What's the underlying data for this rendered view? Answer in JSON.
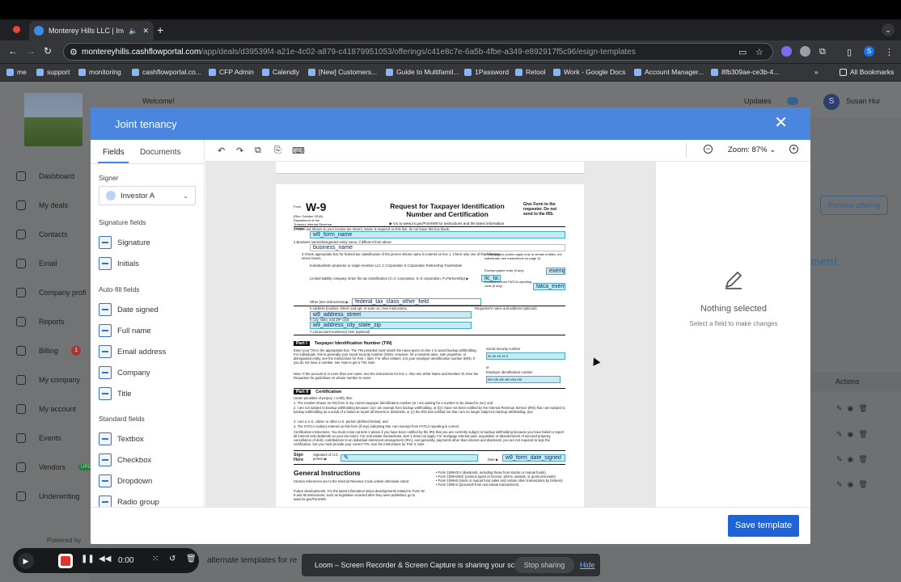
{
  "browser": {
    "tab_title": "Monterey Hills LLC | Inves",
    "url_domain": "montereyhills.cashflowportal.com",
    "url_path": "/app/deals/d39539f4-a21e-4c02-a879-c41879951053/offerings/c41e8c7e-6a5b-4fbe-a349-e892917f5c96/esign-templates",
    "bookmarks": [
      "me",
      "support",
      "monitoring",
      "cashflowportal.co...",
      "CFP Admin",
      "Calendly",
      "[New] Customers...",
      "Guide to Multifamil...",
      "1Password",
      "Retool",
      "Work - Google Docs",
      "Account Manager...",
      "8fb309ae-ce3b-4..."
    ],
    "all_bookmarks": "All Bookmarks",
    "profile_initial": "S"
  },
  "app": {
    "welcome": "Welcome!",
    "updates": "Updates",
    "user_initial": "S",
    "user_name": "Susan Hur",
    "preview_offering": "Preview offering",
    "bg_word": "ment",
    "actions_header": "Actions",
    "powered_by": "Powered by",
    "alt_templates_text": "alternate templates for re",
    "sidebar": [
      {
        "label": "Dashboard"
      },
      {
        "label": "My deals"
      },
      {
        "label": "Contacts"
      },
      {
        "label": "Email"
      },
      {
        "label": "Company profi"
      },
      {
        "label": "Reports"
      },
      {
        "label": "Billing",
        "badge": "1"
      },
      {
        "label": "My company"
      },
      {
        "label": "My account"
      },
      {
        "label": "Events"
      },
      {
        "label": "Vendors",
        "badge": "UPDA"
      },
      {
        "label": "Underwriting"
      }
    ]
  },
  "modal": {
    "title": "Joint tenancy",
    "tabs": {
      "fields": "Fields",
      "documents": "Documents"
    },
    "signer_label": "Signer",
    "signer_value": "Investor A",
    "signer_initial": "IA",
    "signature_fields_label": "Signature fields",
    "signature_fields": [
      "Signature",
      "Initials"
    ],
    "autofill_label": "Auto-fill fields",
    "autofill_fields": [
      "Date signed",
      "Full name",
      "Email address",
      "Company",
      "Title"
    ],
    "standard_label": "Standard fields",
    "standard_fields": [
      "Textbox",
      "Checkbox",
      "Dropdown",
      "Radio group"
    ],
    "zoom": "Zoom: 87%",
    "nothing_selected": "Nothing selected",
    "nothing_sub": "Select a field to make changes",
    "save_button": "Save template"
  },
  "w9": {
    "form": "W-9",
    "form_label": "Form",
    "rev": "(Rev. October 2018) Department of the Treasury Internal Revenue Service",
    "title": "Request for Taxpayer Identification Number and Certification",
    "goto": "▶ Go to www.irs.gov/FormW9 for instructions and the latest information.",
    "give": "Give Form to the requester. Do not send to the IRS.",
    "line1": "1 Name (as shown on your income tax return). Name is required on this line; do not leave this line blank.",
    "line2": "2 Business name/disregarded entity name, if different from above",
    "line3": "3 Check appropriate box for federal tax classification of the person whose name is entered on line 1. Check only one of the following seven boxes.",
    "classes": "Individual/sole proprietor or single-member LLC   C Corporation   S Corporation   Partnership   Trust/estate",
    "llc": "Limited liability company. Enter the tax classification (C=C corporation, S=S corporation, P=Partnership) ▶",
    "other": "Other (see instructions) ▶",
    "line5": "5 Address (number, street, and apt. or suite no.) See instructions.",
    "requester": "Requester's name and address (optional)",
    "line6": "6 City, state, and ZIP code",
    "line7": "7 List account number(s) here (optional)",
    "exemptions": "4 Exemptions (codes apply only to certain entities, not individuals; see instructions on page 3):",
    "exempt_payee": "Exempt payee code (if any)",
    "fatca_label": "Exemption from FATCA reporting code (if any)",
    "fields": {
      "form_name": "w9_form_name",
      "business_name": "business_name",
      "llc": "llc_ta:",
      "exempt": "exemp",
      "fatca": "fatca_exempl",
      "other": "federal_tax_class_other_field",
      "address": "w9_address_street",
      "city": "w9_address_city_state_zip",
      "ssn": "ss ss ss ss s",
      "ein": "ein ein ein ein ein ein",
      "date": "w9_form_date_signed"
    },
    "part1": "Part I",
    "part1_title": "Taxpayer Identification Number (TIN)",
    "part1_text": "Enter your TIN in the appropriate box. The TIN provided must match the name given on line 1 to avoid backup withholding. For individuals, this is generally your social security number (SSN). However, for a resident alien, sole proprietor, or disregarded entity, see the instructions for Part I, later. For other entities, it is your employer identification number (EIN). If you do not have a number, see How to get a TIN, later.",
    "note": "Note: If the account is in more than one name, see the instructions for line 1. Also see What Name and Number To Give the Requester for guidelines on whose number to enter.",
    "ssn_label": "Social security number",
    "or": "or",
    "ein_label": "Employer identification number",
    "part2": "Part II",
    "part2_title": "Certification",
    "cert_intro": "Under penalties of perjury, I certify that:",
    "cert1": "1. The number shown on this form is my correct taxpayer identification number (or I am waiting for a number to be issued to me); and",
    "cert2": "2. I am not subject to backup withholding because: (a) I am exempt from backup withholding, or (b) I have not been notified by the Internal Revenue Service (IRS) that I am subject to backup withholding as a result of a failure to report all interest or dividends, or (c) the IRS has notified me that I am no longer subject to backup withholding; and",
    "cert3": "3. I am a U.S. citizen or other U.S. person (defined below); and",
    "cert4": "4. The FATCA code(s) entered on this form (if any) indicating that I am exempt from FATCA reporting is correct.",
    "cert_instr": "Certification instructions. You must cross out item 2 above if you have been notified by the IRS that you are currently subject to backup withholding because you have failed to report all interest and dividends on your tax return. For real estate transactions, item 2 does not apply. For mortgage interest paid, acquisition or abandonment of secured property, cancellation of debt, contributions to an individual retirement arrangement (IRA), and generally, payments other than interest and dividends, you are not required to sign the certification, but you must provide your correct TIN. See the instructions for Part II, later.",
    "sign_here": "Sign Here",
    "sig_of": "Signature of U.S. person ▶",
    "date_label": "Date ▶",
    "general": "General Instructions",
    "gen1": "Section references are to the Internal Revenue Code unless otherwise noted.",
    "gen2": "Future developments. For the latest information about developments related to Form W-9 and its instructions, such as legislation enacted after they were published, go to www.irs.gov/FormW9.",
    "bullets": "• Form 1099-DIV (dividends, including those from stocks or mutual funds)\n• Form 1099-MISC (various types of income, prizes, awards, or gross proceeds)\n• Form 1099-B (stock or mutual fund sales and certain other transactions by brokers)\n• Form 1099-S (proceeds from real estate transactions)"
  },
  "loom": {
    "time": "0:00",
    "sharing": "Loom – Screen Recorder & Screen Capture is sharing your screen.",
    "stop_sharing": "Stop sharing",
    "hide": "Hide"
  }
}
